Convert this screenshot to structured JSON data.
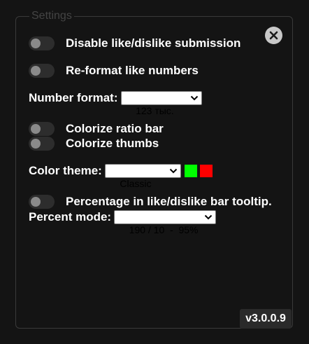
{
  "panel": {
    "legend": "Settings"
  },
  "toggles": {
    "disable_submission": "Disable like/dislike submission",
    "reformat_numbers": "Re-format like numbers",
    "colorize_ratio_bar": "Colorize ratio bar",
    "colorize_thumbs": "Colorize thumbs",
    "percentage_tooltip": "Percentage in like/dislike bar tooltip."
  },
  "number_format": {
    "label": "Number format:",
    "selected": "123 тыс."
  },
  "color_theme": {
    "label": "Color theme:",
    "selected": "Classic",
    "like_color": "#00ff00",
    "dislike_color": "#ff0000"
  },
  "percent_mode": {
    "label": "Percent mode:",
    "selected": "190 / 10  -  95%"
  },
  "version": "v3.0.0.9",
  "icons": {
    "close": "close-icon",
    "dropdown": "chevron-down-icon"
  }
}
